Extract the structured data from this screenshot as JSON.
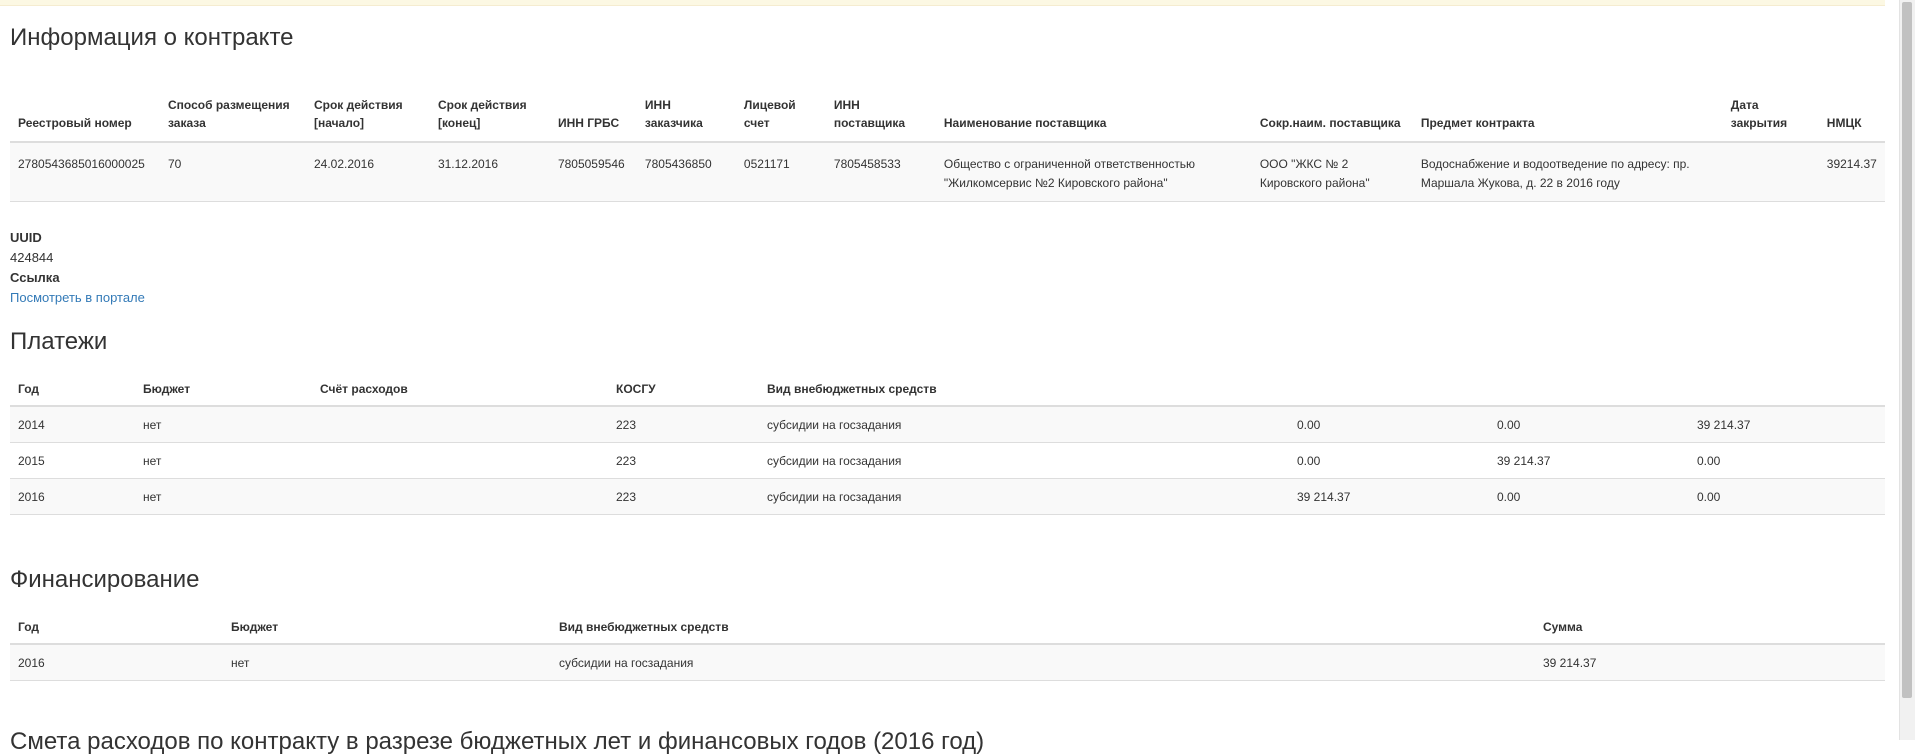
{
  "contract": {
    "title": "Информация о контракте",
    "headers": [
      "Реестровый номер",
      "Способ размещения заказа",
      "Срок действия [начало]",
      "Срок действия [конец]",
      "ИНН ГРБС",
      "ИНН заказчика",
      "Лицевой счет",
      "ИНН поставщика",
      "Наименование поставщика",
      "Сокр.наим. поставщика",
      "Предмет контракта",
      "Дата закрытия",
      "НМЦК"
    ],
    "row": [
      "2780543685016000025",
      "70",
      "24.02.2016",
      "31.12.2016",
      "7805059546",
      "7805436850",
      "0521171",
      "7805458533",
      "Общество с ограниченной ответственностью \"Жилкомсервис №2 Кировского района\"",
      "ООО \"ЖКС № 2 Кировского района\"",
      "Водоснабжение и водоотведение по адресу: пр. Маршала Жукова, д. 22 в 2016 году",
      "",
      "39214.37"
    ]
  },
  "meta": {
    "uuid_label": "UUID",
    "uuid_value": "424844",
    "link_label": "Ссылка",
    "link_text": "Посмотреть в портале"
  },
  "payments": {
    "title": "Платежи",
    "headers": [
      "Год",
      "Бюджет",
      "Счёт расходов",
      "КОСГУ",
      "Вид внебюджетных средств",
      "",
      "",
      ""
    ],
    "rows": [
      [
        "2014",
        "нет",
        "",
        "223",
        "субсидии на госзадания",
        "0.00",
        "0.00",
        "39 214.37"
      ],
      [
        "2015",
        "нет",
        "",
        "223",
        "субсидии на госзадания",
        "0.00",
        "39 214.37",
        "0.00"
      ],
      [
        "2016",
        "нет",
        "",
        "223",
        "субсидии на госзадания",
        "39 214.37",
        "0.00",
        "0.00"
      ]
    ]
  },
  "funding": {
    "title": "Финансирование",
    "headers": [
      "Год",
      "Бюджет",
      "Вид внебюджетных средств",
      "Сумма"
    ],
    "rows": [
      [
        "2016",
        "нет",
        "субсидии на госзадания",
        "39 214.37"
      ]
    ]
  },
  "next_section_partial": "Смета расходов по контракту в разрезе бюджетных лет и финансовых годов (2016 год)"
}
